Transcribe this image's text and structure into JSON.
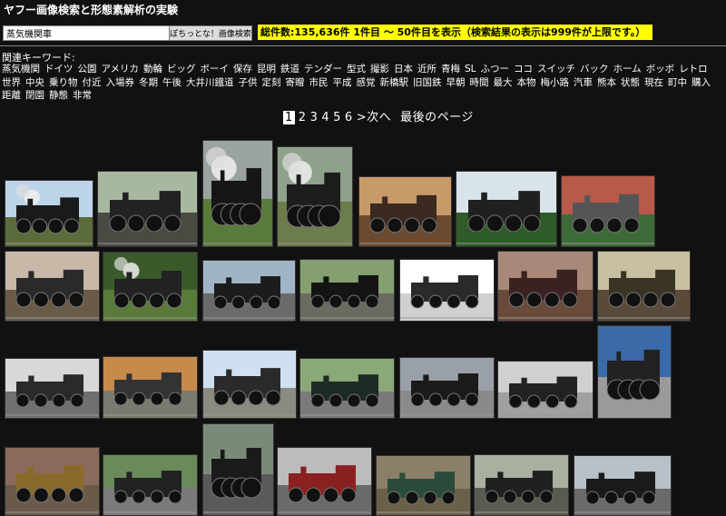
{
  "title": "ヤフー画像検索と形態素解析の実験",
  "search": {
    "value": "蒸気機関車",
    "button_label": "ぽちっとな！画像検索"
  },
  "results_text": "総件数:135,636件 1件目 〜 50件目を表示（検索結果の表示は999件が上限です。）",
  "keywords_label": "関連キーワード:",
  "keywords": [
    "蒸気機関",
    "ドイツ",
    "公園",
    "アメリカ",
    "動輪",
    "ビッグ",
    "ボーイ",
    "保存",
    "昆明",
    "鉄道",
    "テンダー",
    "型式",
    "撮影",
    "日本",
    "近所",
    "青梅",
    "SL",
    "ふつー",
    "ココ",
    "スイッチ",
    "バック",
    "ホーム",
    "ボッボ",
    "レトロ",
    "世界",
    "中央",
    "乗り物",
    "付近",
    "入場券",
    "冬期",
    "午後",
    "大井川鐵道",
    "子供",
    "定刻",
    "寄贈",
    "市民",
    "平成",
    "感覚",
    "新橋駅",
    "旧国鉄",
    "早朝",
    "時間",
    "最大",
    "本物",
    "梅小路",
    "汽車",
    "熊本",
    "状態",
    "現在",
    "町中",
    "購入",
    "距離",
    "閉園",
    "静態",
    "非常"
  ],
  "pager": {
    "pages": [
      "1",
      "2",
      "3",
      "4",
      "5",
      "6"
    ],
    "current": "1",
    "next_label": "次へ",
    "last_label": "最後のページ"
  },
  "colors": {
    "accent": "#ffff00",
    "background": "#111111"
  },
  "thumbnails": [
    {
      "sky": "#bcd4ea",
      "ground": "#5b6b3a",
      "body": "#1a1a1a",
      "steam": true
    },
    {
      "sky": "#a8b8a0",
      "ground": "#4a4a42",
      "body": "#222222",
      "steam": false
    },
    {
      "sky": "#9aa3a0",
      "ground": "#5a7a3a",
      "body": "#161616",
      "steam": true
    },
    {
      "sky": "#8ea18a",
      "ground": "#6c7c4a",
      "body": "#1d1d1d",
      "steam": true
    },
    {
      "sky": "#c89a6a",
      "ground": "#6a4a30",
      "body": "#3a2a20",
      "steam": false
    },
    {
      "sky": "#d8e4ea",
      "ground": "#2f5a2a",
      "body": "#202020",
      "steam": false
    },
    {
      "sky": "#b85a4a",
      "ground": "#3e6a3a",
      "body": "#555555",
      "steam": false
    },
    {
      "sky": "#c8b8a8",
      "ground": "#6a5a48",
      "body": "#2a2a2a",
      "steam": false
    },
    {
      "sky": "#3a5a2a",
      "ground": "#5a7a3a",
      "body": "#222222",
      "steam": true
    },
    {
      "sky": "#a0b4c8",
      "ground": "#6a6a6a",
      "body": "#1c1c1c",
      "steam": false
    },
    {
      "sky": "#84a070",
      "ground": "#6a6a60",
      "body": "#141414",
      "steam": false
    },
    {
      "sky": "#ffffff",
      "ground": "#d0d0d0",
      "body": "#2a2a2a",
      "steam": false
    },
    {
      "sky": "#a88878",
      "ground": "#6a4a3a",
      "body": "#3a2222",
      "steam": false
    },
    {
      "sky": "#c8c0a0",
      "ground": "#5a4a3a",
      "body": "#3a3424",
      "steam": false
    },
    {
      "sky": "#d8d8d8",
      "ground": "#707070",
      "body": "#2a2a2a",
      "steam": false
    },
    {
      "sky": "#c88a4a",
      "ground": "#7a7a70",
      "body": "#333333",
      "steam": false
    },
    {
      "sky": "#cfe0f0",
      "ground": "#8a8a80",
      "body": "#2a2a2a",
      "steam": false
    },
    {
      "sky": "#8aa878",
      "ground": "#7a7a7a",
      "body": "#1e2a24",
      "steam": false
    },
    {
      "sky": "#9aa0a8",
      "ground": "#8a8a88",
      "body": "#1a1a1a",
      "steam": false
    },
    {
      "sky": "#d0d0d0",
      "ground": "#a0a0a0",
      "body": "#222222",
      "steam": false
    },
    {
      "sky": "#3a6aa8",
      "ground": "#9a9a9a",
      "body": "#222222",
      "steam": false
    },
    {
      "sky": "#8a6a5a",
      "ground": "#6a5a4a",
      "body": "#8a6a2a",
      "steam": false
    },
    {
      "sky": "#6a8a5a",
      "ground": "#7a7a7a",
      "body": "#222222",
      "steam": false
    },
    {
      "sky": "#7a8a78",
      "ground": "#5a5a5a",
      "body": "#1a1a1a",
      "steam": false
    },
    {
      "sky": "#bcbcbc",
      "ground": "#6a6a6a",
      "body": "#8a2020",
      "steam": false
    },
    {
      "sky": "#8a8068",
      "ground": "#6a6048",
      "body": "#2a4a3a",
      "steam": false
    },
    {
      "sky": "#a8b0a0",
      "ground": "#5a5a50",
      "body": "#202020",
      "steam": false
    },
    {
      "sky": "#b8c0c8",
      "ground": "#6a6a6a",
      "body": "#1a1a1a",
      "steam": false
    }
  ]
}
